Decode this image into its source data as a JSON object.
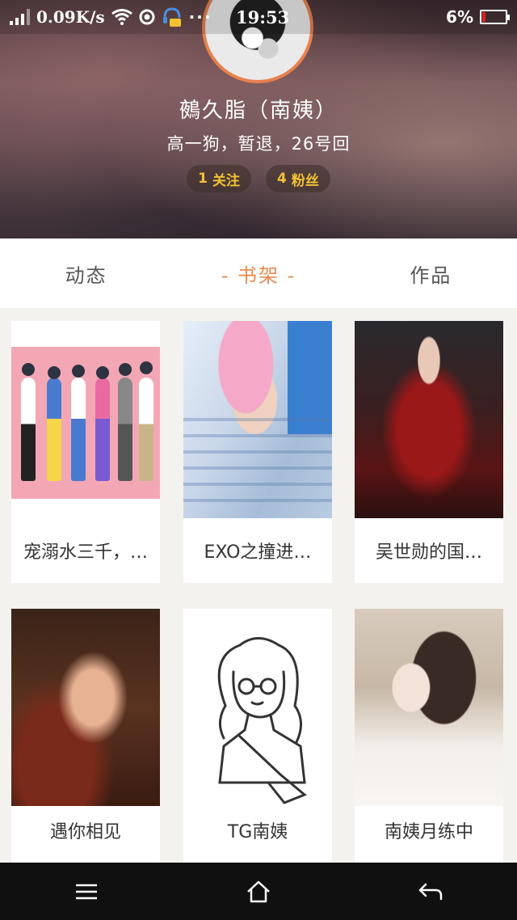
{
  "status_bar": {
    "speed": "0.09K/s",
    "dots": "···",
    "time": "19:53",
    "battery": "6%",
    "battery_color": "#e02020"
  },
  "profile": {
    "name": "鵺久脂（南姨）",
    "bio": "高一狗，暂退，26号回",
    "following_count": "1",
    "following_label": "关注",
    "followers_count": "4",
    "followers_label": "粉丝",
    "accent_color": "#e8804e",
    "pill_text_color": "#f2c233"
  },
  "tabs": [
    {
      "label": "动态"
    },
    {
      "label": "- 书架 -"
    },
    {
      "label": "作品"
    }
  ],
  "books": [
    {
      "title": "宠溺水三千，…"
    },
    {
      "title": "EXO之撞进…"
    },
    {
      "title": "吴世勋的国…"
    },
    {
      "title": "遇你相见"
    },
    {
      "title": "TG南姨"
    },
    {
      "title": "南姨月练中"
    }
  ],
  "nav": {
    "menu_icon": "menu-icon",
    "home_icon": "home-icon",
    "back_icon": "back-icon"
  }
}
